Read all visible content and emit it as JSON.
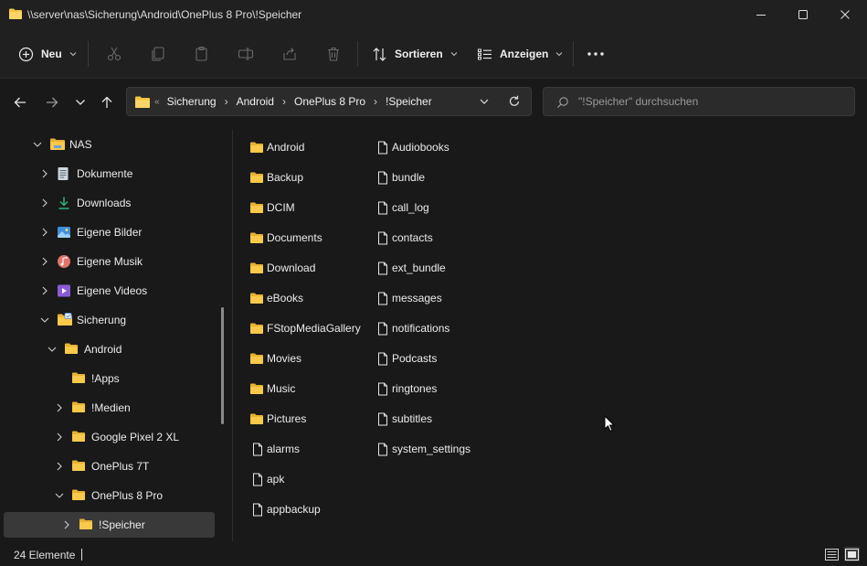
{
  "window": {
    "title": "\\\\server\\nas\\Sicherung\\Android\\OnePlus 8 Pro\\!Speicher"
  },
  "toolbar": {
    "new_label": "Neu",
    "sort_label": "Sortieren",
    "view_label": "Anzeigen"
  },
  "address": {
    "crumbs": [
      "Sicherung",
      "Android",
      "OnePlus 8 Pro",
      "!Speicher"
    ]
  },
  "search": {
    "placeholder": "\"!Speicher\" durchsuchen"
  },
  "tree": {
    "items": [
      {
        "label": "NAS",
        "icon": "nas-folder-icon",
        "expanded": true
      },
      {
        "label": "Dokumente",
        "icon": "documents-icon"
      },
      {
        "label": "Downloads",
        "icon": "downloads-icon"
      },
      {
        "label": "Eigene Bilder",
        "icon": "pictures-icon"
      },
      {
        "label": "Eigene Musik",
        "icon": "music-icon"
      },
      {
        "label": "Eigene Videos",
        "icon": "videos-icon"
      },
      {
        "label": "Sicherung",
        "icon": "backup-folder-icon",
        "expanded": true
      },
      {
        "label": "Android",
        "icon": "folder-icon",
        "expanded": true
      },
      {
        "label": "!Apps",
        "icon": "folder-icon"
      },
      {
        "label": "!Medien",
        "icon": "folder-icon"
      },
      {
        "label": "Google Pixel 2 XL",
        "icon": "folder-icon"
      },
      {
        "label": "OnePlus 7T",
        "icon": "folder-icon"
      },
      {
        "label": "OnePlus 8 Pro",
        "icon": "folder-icon",
        "expanded": true
      },
      {
        "label": "!Speicher",
        "icon": "folder-icon",
        "selected": true
      }
    ]
  },
  "files": {
    "column1": [
      {
        "name": "Android",
        "type": "folder"
      },
      {
        "name": "Backup",
        "type": "folder"
      },
      {
        "name": "DCIM",
        "type": "folder"
      },
      {
        "name": "Documents",
        "type": "folder"
      },
      {
        "name": "Download",
        "type": "folder"
      },
      {
        "name": "eBooks",
        "type": "folder"
      },
      {
        "name": "FStopMediaGallery",
        "type": "folder"
      },
      {
        "name": "Movies",
        "type": "folder"
      },
      {
        "name": "Music",
        "type": "folder"
      },
      {
        "name": "Pictures",
        "type": "folder"
      },
      {
        "name": "alarms",
        "type": "file"
      },
      {
        "name": "apk",
        "type": "file"
      },
      {
        "name": "appbackup",
        "type": "file"
      }
    ],
    "column2": [
      {
        "name": "Audiobooks",
        "type": "file"
      },
      {
        "name": "bundle",
        "type": "file"
      },
      {
        "name": "call_log",
        "type": "file"
      },
      {
        "name": "contacts",
        "type": "file"
      },
      {
        "name": "ext_bundle",
        "type": "file"
      },
      {
        "name": "messages",
        "type": "file"
      },
      {
        "name": "notifications",
        "type": "file"
      },
      {
        "name": "Podcasts",
        "type": "file"
      },
      {
        "name": "ringtones",
        "type": "file"
      },
      {
        "name": "subtitles",
        "type": "file"
      },
      {
        "name": "system_settings",
        "type": "file"
      }
    ]
  },
  "status": {
    "count": "24 Elemente"
  },
  "colors": {
    "folder": "#F5C542",
    "background": "#191919",
    "chrome": "#202020"
  }
}
